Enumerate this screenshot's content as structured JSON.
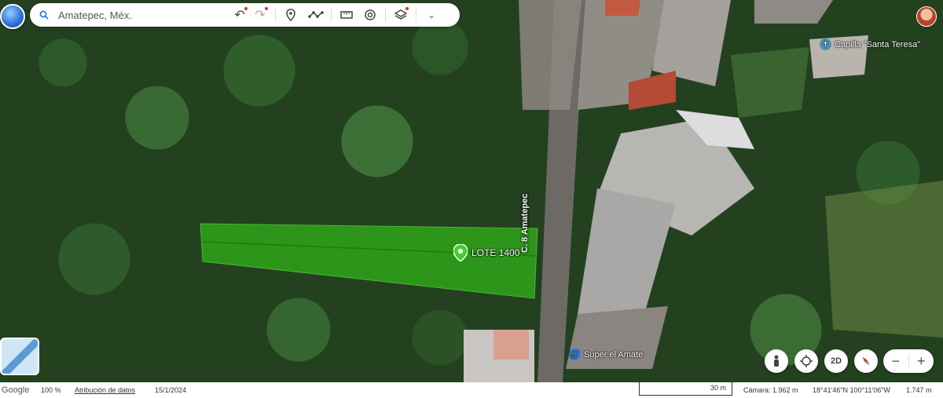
{
  "search": {
    "value": "Amatepec, Méx."
  },
  "map": {
    "parcel_label": "LOTE 1400",
    "parcel_color": "#2ea81a",
    "road_label": "C. 8 Amatepec",
    "pois": [
      {
        "label": "Capilla \"Santa Teresa\"",
        "icon": "church-icon"
      },
      {
        "label": "Super el Amate",
        "icon": "shopping-cart-icon"
      }
    ]
  },
  "controls": {
    "view_mode": "2D"
  },
  "status": {
    "brand": "Google",
    "zoom": "100 %",
    "attribution": "Atribución de datos",
    "date": "15/1/2024",
    "scale": "30 m",
    "camera": "Cámara: 1.962 m",
    "coords": "18°41'46\"N 100°11'06\"W",
    "elevation": "1.747 m"
  }
}
